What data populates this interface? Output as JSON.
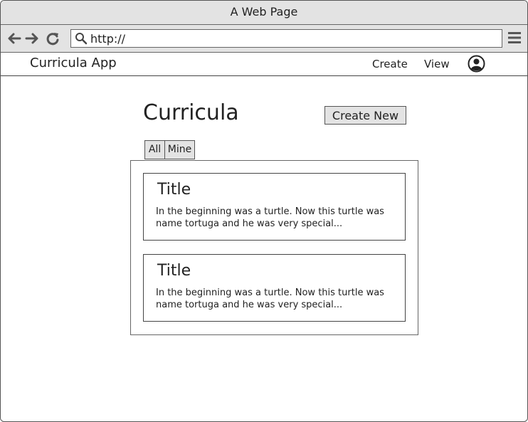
{
  "browser": {
    "window_title": "A Web Page",
    "url": "http://"
  },
  "app": {
    "brand": "Curricula App",
    "nav": {
      "create": "Create",
      "view": "View"
    }
  },
  "page": {
    "title": "Curricula",
    "create_button": "Create New",
    "tabs": [
      {
        "label": "All"
      },
      {
        "label": "Mine"
      }
    ],
    "cards": [
      {
        "title": "Title",
        "body": "In the beginning was a turtle. Now this turtle was name tortuga and he was very special..."
      },
      {
        "title": "Title",
        "body": "In the beginning was a turtle. Now this turtle was name tortuga and he was very special..."
      }
    ]
  },
  "icons": {
    "back": "arrow-left-icon",
    "forward": "arrow-right-icon",
    "reload": "reload-icon",
    "search": "search-icon",
    "menu": "hamburger-menu-icon",
    "user": "user-avatar-icon"
  }
}
